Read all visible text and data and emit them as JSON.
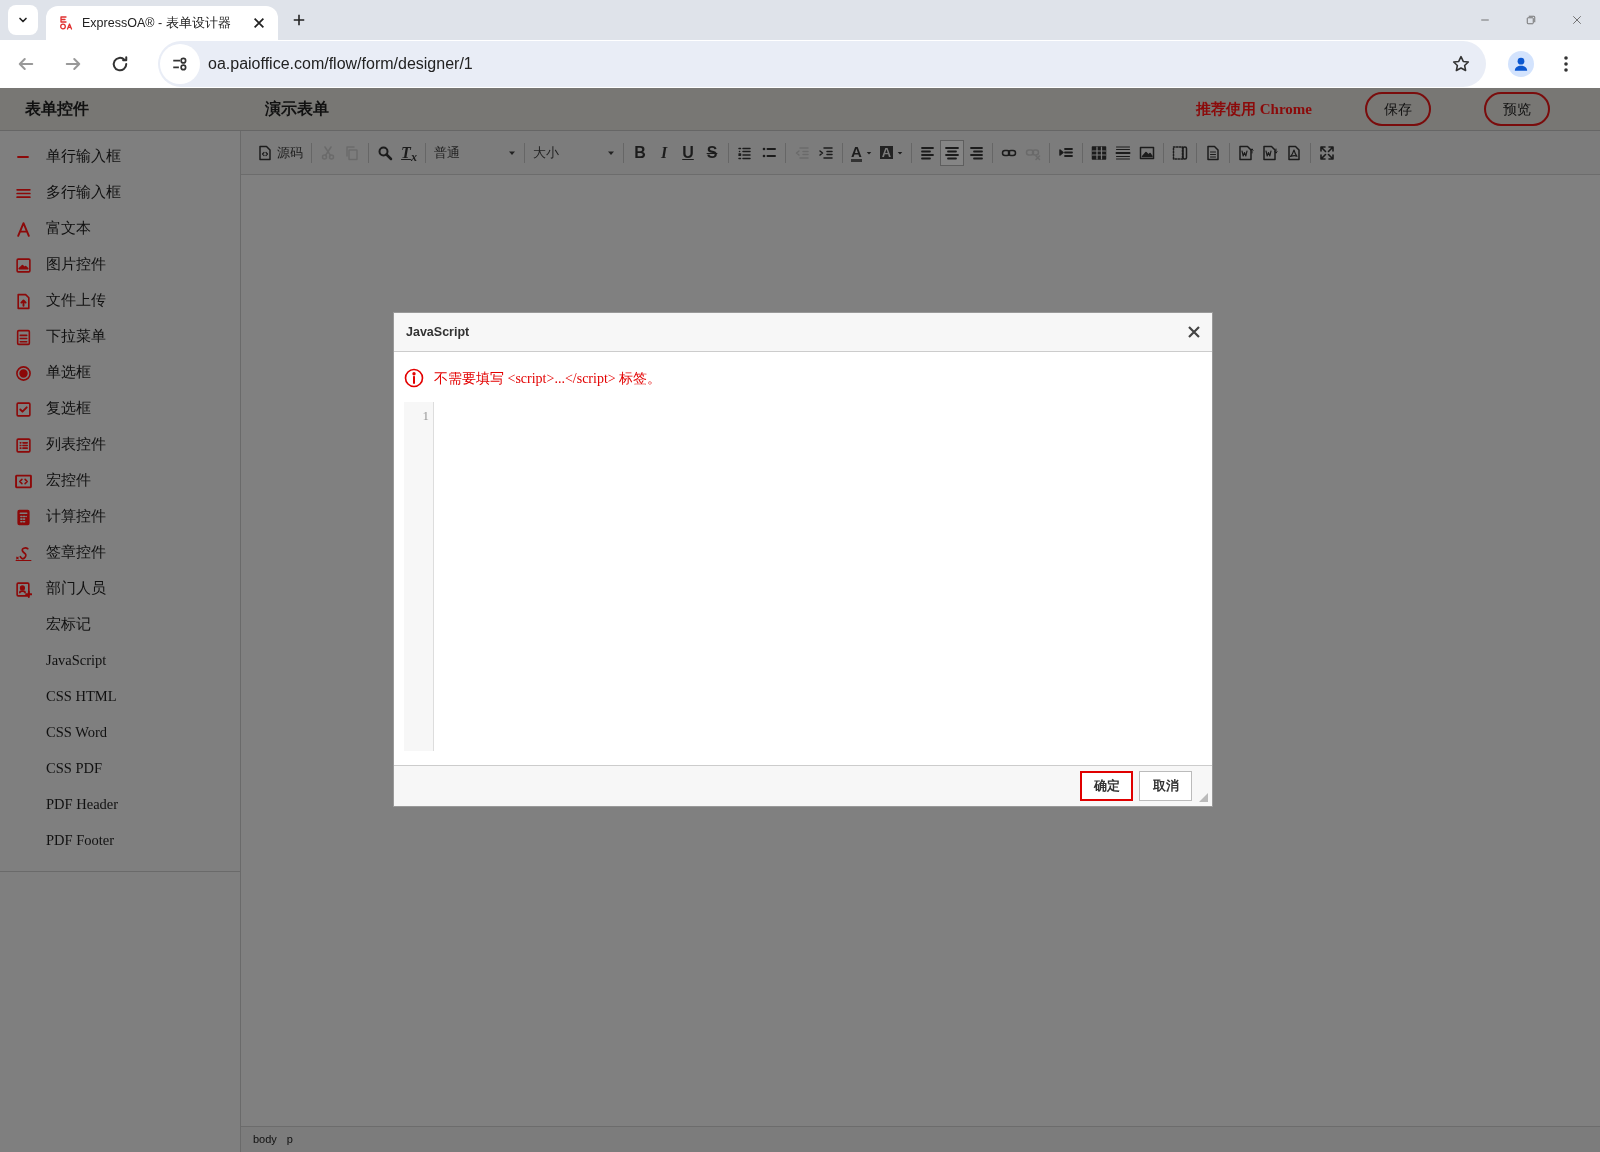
{
  "browser": {
    "tab_title": "ExpressOA® - 表单设计器",
    "url": "oa.paioffice.com/flow/form/designer/1"
  },
  "header": {
    "sidebar_title": "表单控件",
    "form_title": "演示表单",
    "notice": "推荐使用 Chrome",
    "buttons": [
      "保存",
      "预览"
    ]
  },
  "sidebar": {
    "items": [
      {
        "label": "单行输入框",
        "kind": "control"
      },
      {
        "label": "多行输入框",
        "kind": "control"
      },
      {
        "label": "富文本",
        "kind": "control"
      },
      {
        "label": "图片控件",
        "kind": "control"
      },
      {
        "label": "文件上传",
        "kind": "control"
      },
      {
        "label": "下拉菜单",
        "kind": "control"
      },
      {
        "label": "单选框",
        "kind": "control"
      },
      {
        "label": "复选框",
        "kind": "control"
      },
      {
        "label": "列表控件",
        "kind": "control"
      },
      {
        "label": "宏控件",
        "kind": "control"
      },
      {
        "label": "计算控件",
        "kind": "control"
      },
      {
        "label": "签章控件",
        "kind": "control"
      },
      {
        "label": "部门人员",
        "kind": "control"
      },
      {
        "label": "宏标记",
        "kind": "text"
      },
      {
        "label": "JavaScript",
        "kind": "text"
      },
      {
        "label": "CSS HTML",
        "kind": "text"
      },
      {
        "label": "CSS Word",
        "kind": "text"
      },
      {
        "label": "CSS PDF",
        "kind": "text"
      },
      {
        "label": "PDF Header",
        "kind": "text"
      },
      {
        "label": "PDF Footer",
        "kind": "text"
      }
    ]
  },
  "toolbar": [
    {
      "kind": "button",
      "label": "源码",
      "disabled": false,
      "selected": false
    },
    {
      "kind": "separator"
    },
    {
      "kind": "button",
      "disabled": true,
      "selected": false
    },
    {
      "kind": "button",
      "disabled": true,
      "selected": false
    },
    {
      "kind": "separator"
    },
    {
      "kind": "button",
      "disabled": false,
      "selected": false
    },
    {
      "kind": "button",
      "label": "T$_{x}$",
      "disabled": false,
      "selected": false
    },
    {
      "kind": "separator"
    },
    {
      "kind": "combo",
      "label": "普通"
    },
    {
      "kind": "separator"
    },
    {
      "kind": "combo",
      "label": "大小"
    },
    {
      "kind": "separator"
    },
    {
      "kind": "button",
      "label": "B",
      "disabled": false,
      "selected": false
    },
    {
      "kind": "button",
      "label": "I",
      "disabled": false,
      "selected": false
    },
    {
      "kind": "button",
      "label": "U",
      "disabled": false,
      "selected": false
    },
    {
      "kind": "button",
      "label": "S",
      "disabled": false,
      "selected": false
    },
    {
      "kind": "separator"
    },
    {
      "kind": "button",
      "disabled": false,
      "selected": false
    },
    {
      "kind": "button",
      "disabled": false,
      "selected": false
    },
    {
      "kind": "separator"
    },
    {
      "kind": "button",
      "disabled": true,
      "selected": false
    },
    {
      "kind": "button",
      "disabled": false,
      "selected": false
    },
    {
      "kind": "separator"
    },
    {
      "kind": "button",
      "label": "A",
      "disabled": false,
      "selected": false
    },
    {
      "kind": "button",
      "label": "A",
      "disabled": false,
      "selected": false
    },
    {
      "kind": "separator"
    },
    {
      "kind": "button",
      "disabled": false,
      "selected": false
    },
    {
      "kind": "button",
      "disabled": false,
      "selected": true
    },
    {
      "kind": "button",
      "disabled": false,
      "selected": false
    },
    {
      "kind": "separator"
    },
    {
      "kind": "button",
      "disabled": false,
      "selected": false
    },
    {
      "kind": "button",
      "disabled": true,
      "selected": false
    },
    {
      "kind": "separator"
    },
    {
      "kind": "button",
      "disabled": false,
      "selected": false
    },
    {
      "kind": "separator"
    },
    {
      "kind": "button",
      "disabled": false,
      "selected": false
    },
    {
      "kind": "button",
      "disabled": false,
      "selected": false
    },
    {
      "kind": "button",
      "disabled": false,
      "selected": false
    },
    {
      "kind": "separator"
    },
    {
      "kind": "button",
      "disabled": false,
      "selected": false
    },
    {
      "kind": "separator"
    },
    {
      "kind": "button",
      "disabled": false,
      "selected": false
    },
    {
      "kind": "separator"
    },
    {
      "kind": "button",
      "disabled": false,
      "selected": false
    },
    {
      "kind": "button",
      "disabled": false,
      "selected": false
    },
    {
      "kind": "button",
      "disabled": false,
      "selected": false
    },
    {
      "kind": "separator"
    },
    {
      "kind": "button",
      "disabled": false,
      "selected": false
    }
  ],
  "status_bar": [
    "body",
    "p"
  ],
  "dialog": {
    "title": "JavaScript",
    "notice": "不需要填写 <script>...</script> 标签。",
    "line_numbers": [
      "1"
    ],
    "buttons": [
      {
        "label": "确定",
        "primary": true
      },
      {
        "label": "取消",
        "primary": false
      }
    ]
  }
}
